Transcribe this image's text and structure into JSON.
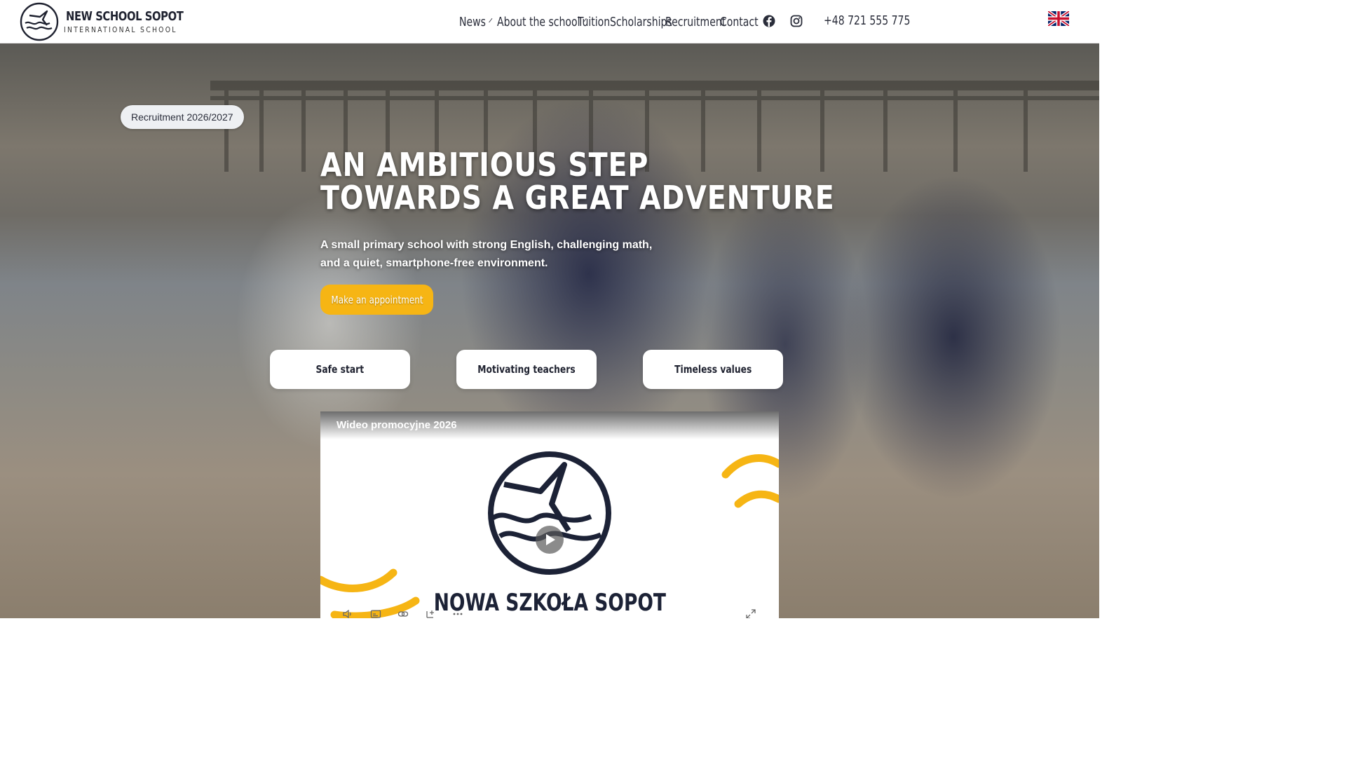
{
  "header": {
    "brand_name": "NEW SCHOOL SOPOT",
    "brand_sub": "INTERNATIONAL SCHOOL",
    "nav": [
      {
        "label": "News",
        "dropdown": true
      },
      {
        "label": "About the school",
        "dropdown": true
      },
      {
        "label": "Tuition",
        "dropdown": false
      },
      {
        "label": "Scholarships",
        "dropdown": false
      },
      {
        "label": "Recruitment",
        "dropdown": false
      },
      {
        "label": "Contact",
        "dropdown": false
      }
    ],
    "social_icons": [
      "facebook-icon",
      "instagram-icon"
    ],
    "phone": "+48 721 555 775",
    "language_flag": "uk-flag-icon"
  },
  "hero": {
    "badge": "Recruitment 2026/2027",
    "headline_line1": "AN AMBITIOUS STEP",
    "headline_line2": "TOWARDS A GREAT ADVENTURE",
    "subtext_line1": "A small primary school with strong English, challenging math,",
    "subtext_line2": "and a quiet, smartphone-free environment.",
    "cta_label": "Make an appointment",
    "features": [
      "Safe start",
      "Motivating teachers",
      "Timeless values"
    ]
  },
  "video": {
    "title": "Wideo promocyjne 2026",
    "brand_text": "NOWA SZKOŁA SOPOT",
    "controls": [
      "volume-icon",
      "captions-icon",
      "link-icon",
      "add-icon",
      "more-icon",
      "fullscreen-icon"
    ]
  },
  "colors": {
    "accent_yellow": "#f6b514",
    "navy": "#1c2236",
    "uk_blue": "#012169",
    "uk_red": "#c8102e"
  }
}
